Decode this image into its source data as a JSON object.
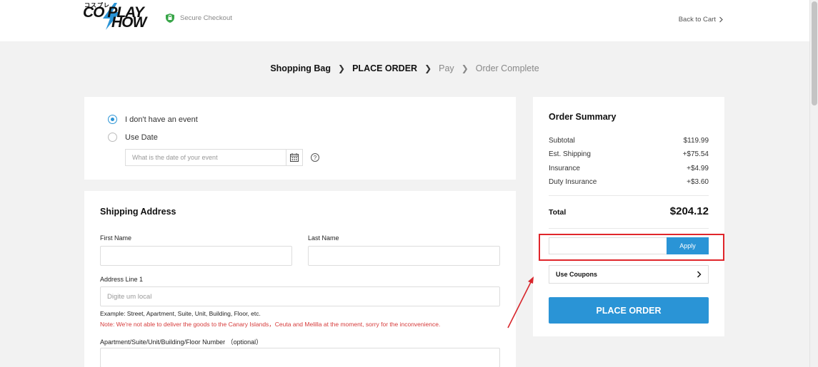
{
  "header": {
    "logo_kana": "コスプレ",
    "logo_line1": "CO PLAY",
    "logo_line2": "HOW",
    "secure_label": "Secure Checkout",
    "back_label": "Back to Cart"
  },
  "steps": [
    {
      "label": "Shopping Bag"
    },
    {
      "label": "PLACE ORDER"
    },
    {
      "label": "Pay"
    },
    {
      "label": "Order Complete"
    }
  ],
  "event": {
    "option_no_event": "I don't have an event",
    "option_use_date": "Use Date",
    "selected": "no_event",
    "date_placeholder": "What is the date of your event"
  },
  "shipping": {
    "title": "Shipping Address",
    "first_name_label": "First Name",
    "last_name_label": "Last Name",
    "address1_label": "Address Line 1",
    "address1_placeholder": "Digite um local",
    "address_example": "Example: Street, Apartment, Suite, Unit, Building, Floor, etc.",
    "address_note": "Note: We're not able to deliver the goods to the Canary Islands，Ceuta and Melilla at the moment, sorry for the inconvenience.",
    "apartment_label": "Apartment/Suite/Unit/Building/Floor Number （optional）"
  },
  "summary": {
    "title": "Order Summary",
    "rows": [
      {
        "label": "Subtotal",
        "value": "$119.99"
      },
      {
        "label": "Est. Shipping",
        "value": "+$75.54"
      },
      {
        "label": "Insurance",
        "value": "+$4.99"
      },
      {
        "label": "Duty Insurance",
        "value": "+$3.60"
      }
    ],
    "total_label": "Total",
    "total_value": "$204.12",
    "coupon_value": "",
    "apply_label": "Apply",
    "use_coupons_label": "Use Coupons",
    "place_order_label": "PLACE ORDER"
  },
  "colors": {
    "accent": "#2a94d6",
    "highlight": "#e0262b",
    "note": "#d63b3b"
  }
}
